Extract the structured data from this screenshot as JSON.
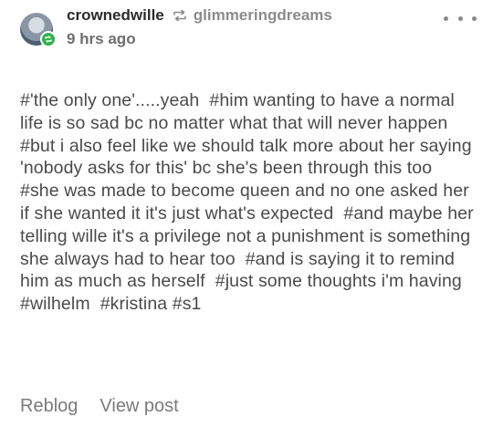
{
  "header": {
    "author": "crownedwille",
    "source": "glimmeringdreams",
    "timestamp": "9 hrs ago"
  },
  "icons": {
    "reblog": "reblog-icon",
    "more": "more-options-icon",
    "badge": "reblog-badge-icon"
  },
  "colors": {
    "badge": "#2fb24c",
    "text": "#4a4a4a",
    "muted": "#8b8b8b"
  },
  "body": {
    "tags": [
      "#'the only one'.....yeah",
      "#him wanting to have a normal life is so sad bc no matter what that will never happen",
      "#but i also feel like we should talk more about her saying 'nobody asks for this' bc she's been through this too",
      "#she was made to become queen and no one asked her if she wanted it it's just what's expected",
      "#and maybe her telling wille it's a privilege not a punishment is something she always had to hear too",
      "#and is saying it to remind him as much as herself",
      "#just some thoughts i'm having",
      "#wilhelm",
      "#kristina",
      "#s1"
    ]
  },
  "footer": {
    "reblog_label": "Reblog",
    "view_post_label": "View post"
  }
}
